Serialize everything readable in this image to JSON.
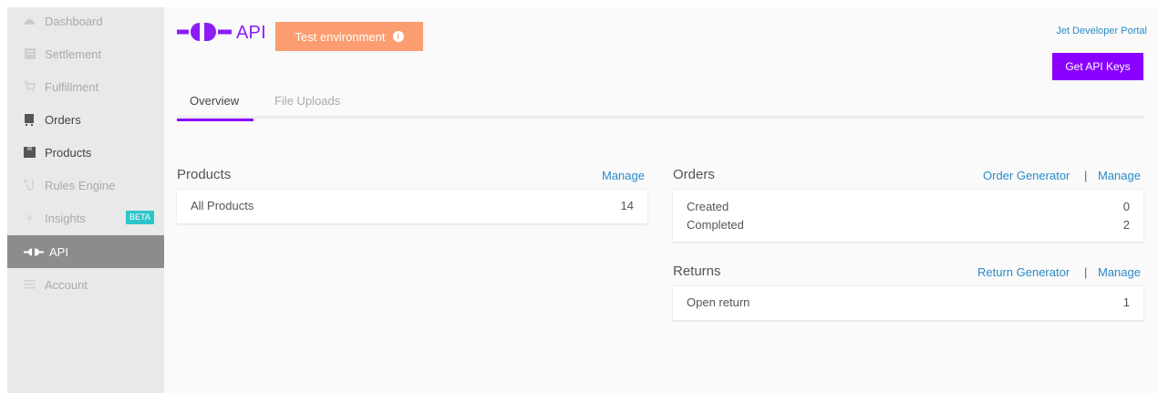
{
  "sidebar": {
    "items": [
      {
        "label": "Dashboard",
        "icon": "dashboard-icon"
      },
      {
        "label": "Settlement",
        "icon": "settlement-icon"
      },
      {
        "label": "Fulfillment",
        "icon": "fulfillment-icon"
      },
      {
        "label": "Orders",
        "icon": "orders-icon"
      },
      {
        "label": "Products",
        "icon": "products-icon"
      },
      {
        "label": "Rules Engine",
        "icon": "rules-engine-icon"
      },
      {
        "label": "Insights",
        "icon": "insights-icon",
        "badge": "BETA"
      },
      {
        "label": "API",
        "icon": "api-plug-icon",
        "active": true
      },
      {
        "label": "Account",
        "icon": "account-icon"
      }
    ]
  },
  "header": {
    "logo_text": "API",
    "test_env_label": "Test environment",
    "portal_link": "Jet Developer Portal",
    "api_keys_button": "Get API Keys"
  },
  "tabs": [
    {
      "label": "Overview",
      "active": true
    },
    {
      "label": "File Uploads",
      "active": false
    }
  ],
  "products": {
    "title": "Products",
    "manage_link": "Manage",
    "rows": [
      {
        "label": "All Products",
        "value": "14"
      }
    ]
  },
  "orders": {
    "title": "Orders",
    "generator_link": "Order Generator",
    "separator": "|",
    "manage_link": "Manage",
    "rows": [
      {
        "label": "Created",
        "value": "0"
      },
      {
        "label": "Completed",
        "value": "2"
      }
    ]
  },
  "returns": {
    "title": "Returns",
    "generator_link": "Return Generator",
    "separator": "|",
    "manage_link": "Manage",
    "rows": [
      {
        "label": "Open return",
        "value": "1"
      }
    ]
  },
  "colors": {
    "accent_purple": "#8a00ff",
    "test_env_orange": "#fb9d70",
    "link_blue": "#2a8bc8",
    "beta_teal": "#2ec5c9",
    "sidebar_bg": "#e9e9e9",
    "sidebar_active": "#8c8c8c"
  }
}
